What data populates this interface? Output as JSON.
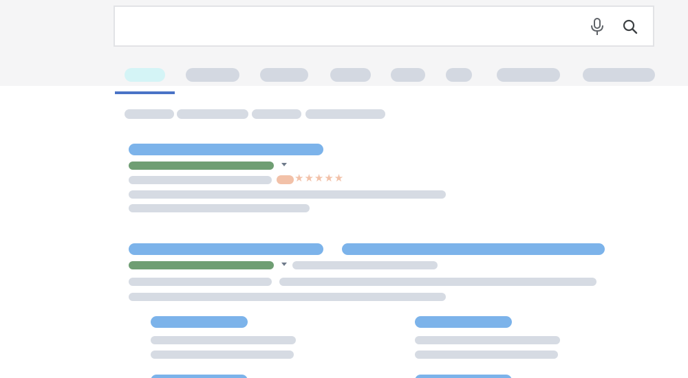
{
  "search": {
    "value": "",
    "placeholder": "",
    "mic_icon": "microphone-icon",
    "search_icon": "magnifier-icon"
  },
  "tabs": {
    "count": 8,
    "active_index": 0
  },
  "colors": {
    "header_bg": "#f5f5f6",
    "placeholder_gray": "#d3d8e1",
    "link_blue": "#7cb3ea",
    "url_green": "#6f9e73",
    "active_tab": "#d4f4f6",
    "tab_underline": "#4a73c6",
    "rating_orange": "#f2c1a8"
  },
  "results": [
    {
      "rating": {
        "stars": "★★★★★",
        "value": 5,
        "max": 5
      }
    },
    {
      "sitelinks_count": 4
    }
  ]
}
